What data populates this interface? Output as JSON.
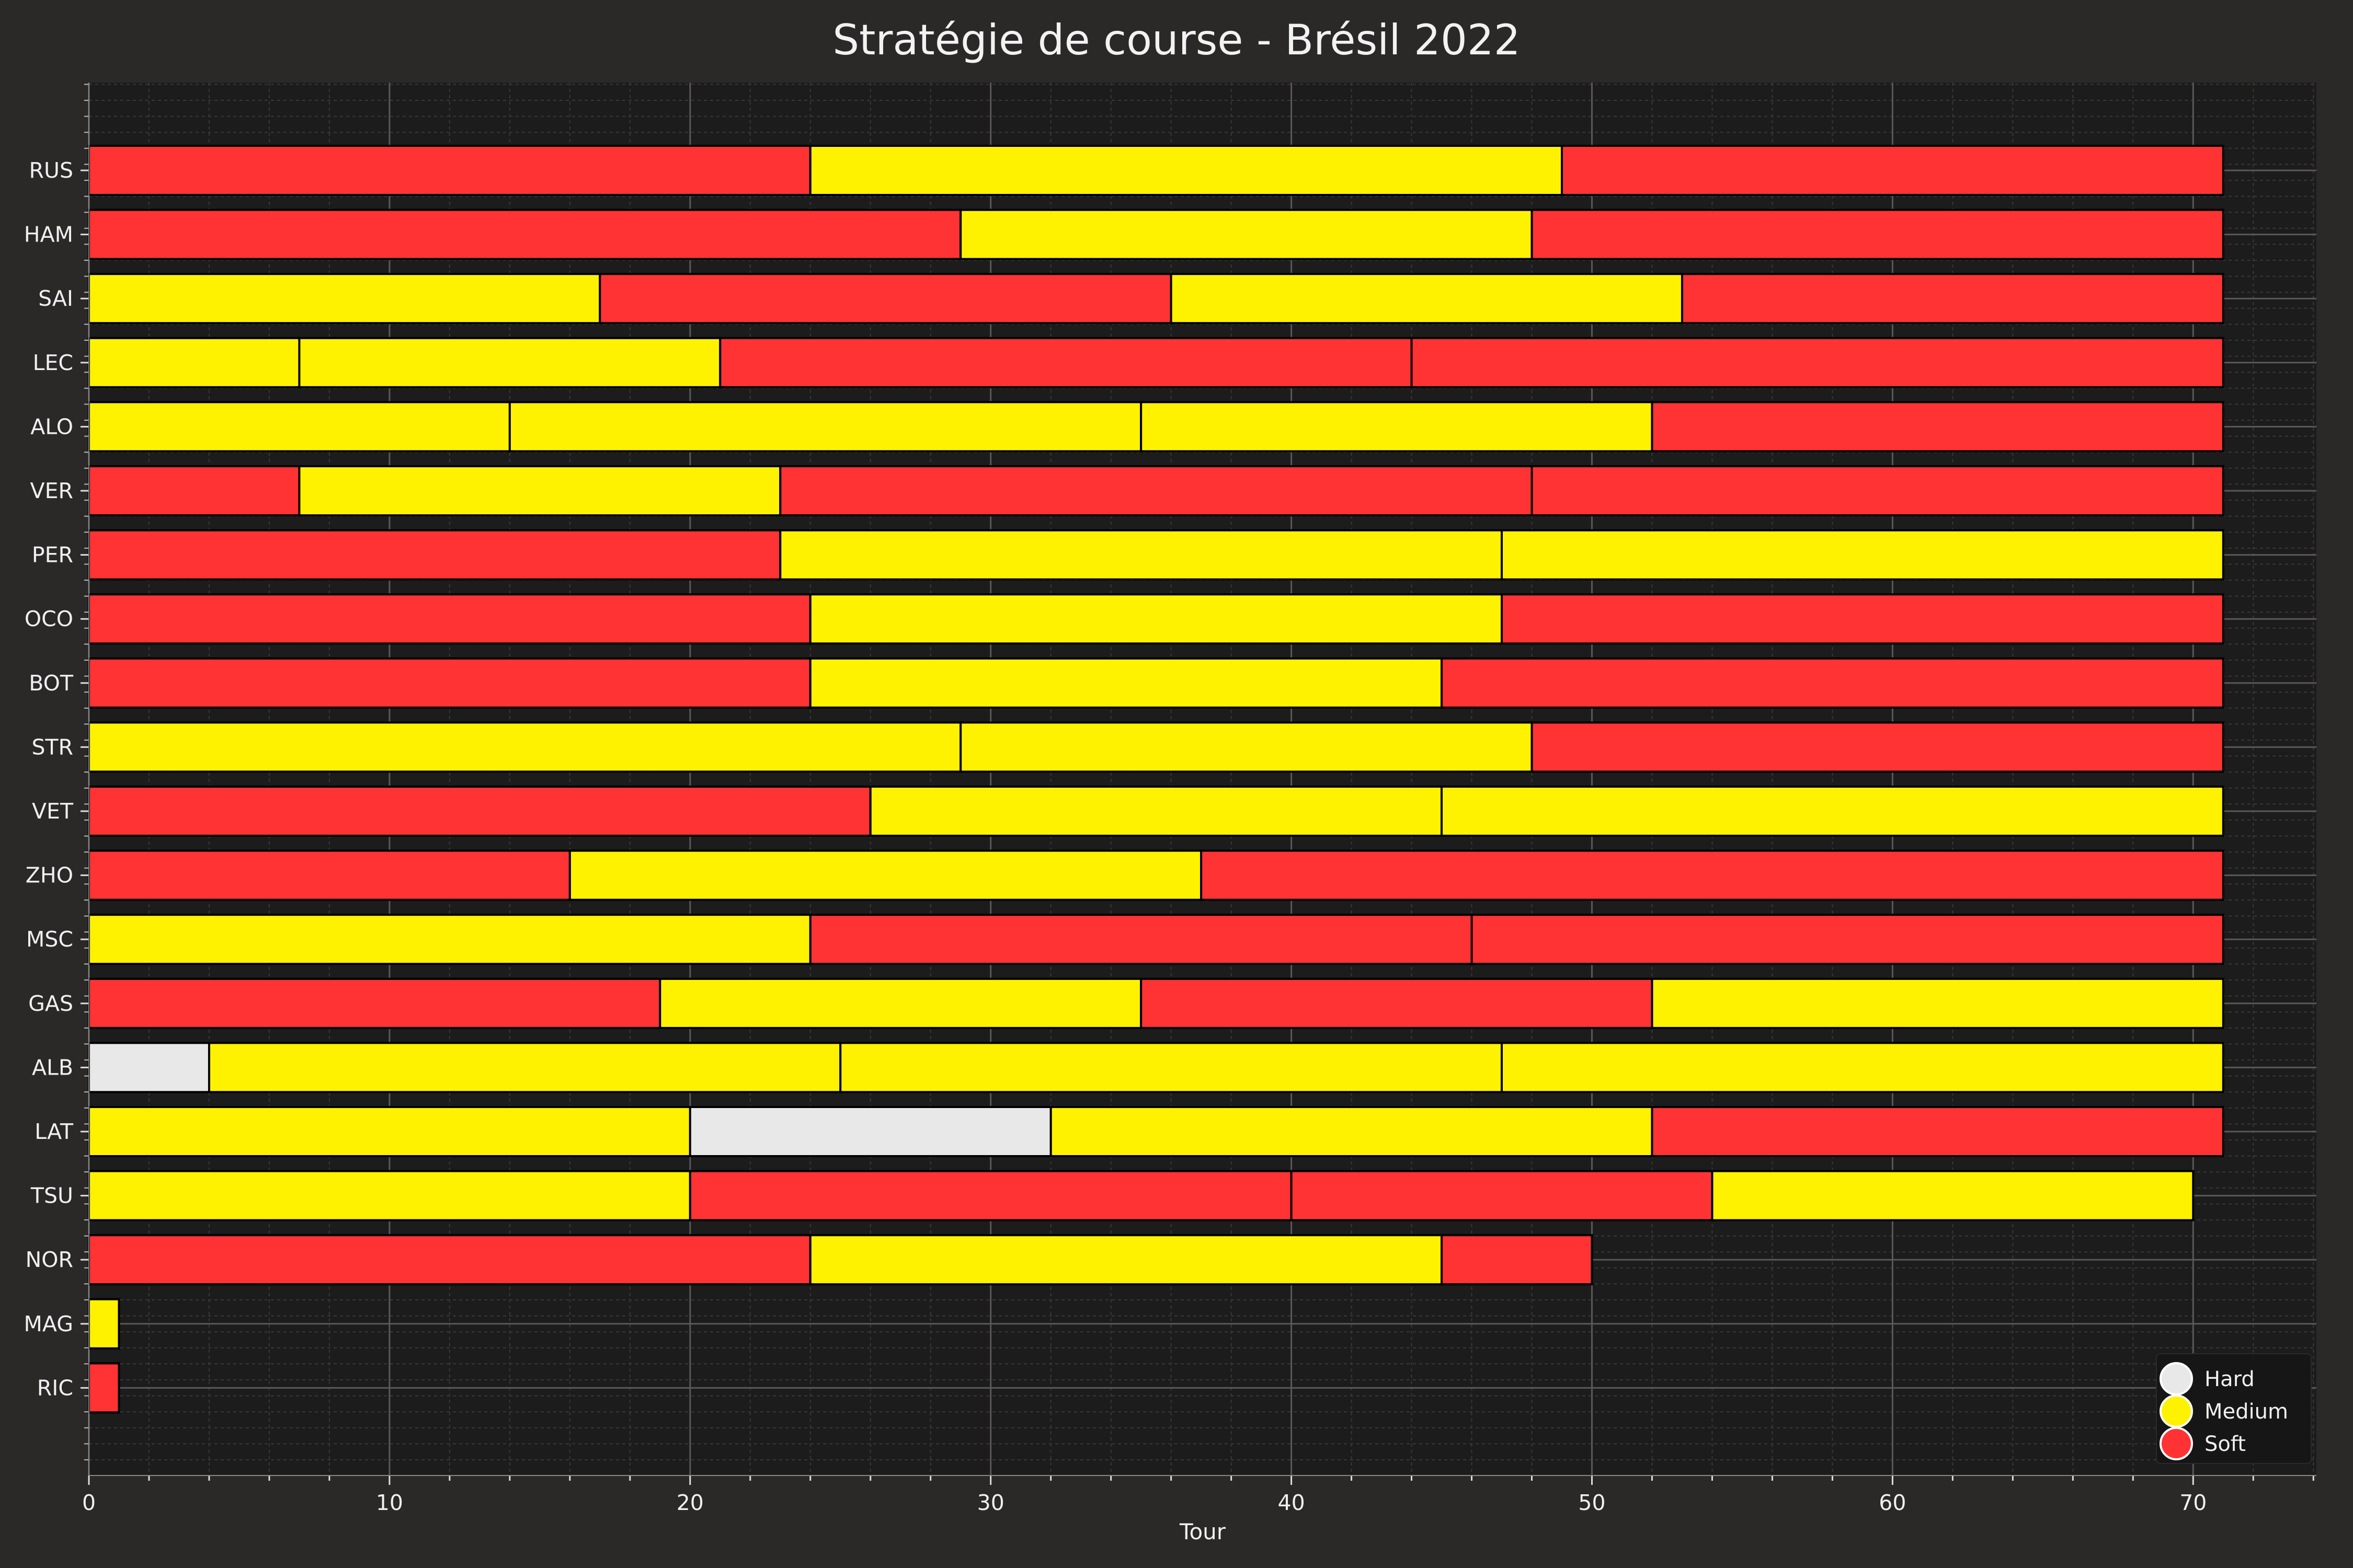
{
  "chart_data": {
    "type": "bar",
    "orientation": "horizontal-stacked",
    "title": "Stratégie de course - Brésil 2022",
    "xlabel": "Tour",
    "ylabel": "",
    "xlim": [
      0,
      74.1
    ],
    "xticks": [
      0,
      10,
      20,
      30,
      40,
      50,
      60,
      70
    ],
    "grid": true,
    "legend_position": "bottom-right",
    "compounds": [
      {
        "name": "Hard",
        "color": "#e8e8e8"
      },
      {
        "name": "Medium",
        "color": "#fff200"
      },
      {
        "name": "Soft",
        "color": "#ff3333"
      }
    ],
    "drivers": [
      {
        "driver": "RUS",
        "stints": [
          {
            "compound": "Soft",
            "start": 0,
            "end": 24
          },
          {
            "compound": "Medium",
            "start": 24,
            "end": 49
          },
          {
            "compound": "Soft",
            "start": 49,
            "end": 71
          }
        ]
      },
      {
        "driver": "HAM",
        "stints": [
          {
            "compound": "Soft",
            "start": 0,
            "end": 29
          },
          {
            "compound": "Medium",
            "start": 29,
            "end": 48
          },
          {
            "compound": "Soft",
            "start": 48,
            "end": 71
          }
        ]
      },
      {
        "driver": "SAI",
        "stints": [
          {
            "compound": "Medium",
            "start": 0,
            "end": 17
          },
          {
            "compound": "Soft",
            "start": 17,
            "end": 36
          },
          {
            "compound": "Medium",
            "start": 36,
            "end": 53
          },
          {
            "compound": "Soft",
            "start": 53,
            "end": 71
          }
        ]
      },
      {
        "driver": "LEC",
        "stints": [
          {
            "compound": "Medium",
            "start": 0,
            "end": 7
          },
          {
            "compound": "Medium",
            "start": 7,
            "end": 21
          },
          {
            "compound": "Soft",
            "start": 21,
            "end": 44
          },
          {
            "compound": "Soft",
            "start": 44,
            "end": 71
          }
        ]
      },
      {
        "driver": "ALO",
        "stints": [
          {
            "compound": "Medium",
            "start": 0,
            "end": 14
          },
          {
            "compound": "Medium",
            "start": 14,
            "end": 35
          },
          {
            "compound": "Medium",
            "start": 35,
            "end": 52
          },
          {
            "compound": "Soft",
            "start": 52,
            "end": 71
          }
        ]
      },
      {
        "driver": "VER",
        "stints": [
          {
            "compound": "Soft",
            "start": 0,
            "end": 7
          },
          {
            "compound": "Medium",
            "start": 7,
            "end": 23
          },
          {
            "compound": "Soft",
            "start": 23,
            "end": 48
          },
          {
            "compound": "Soft",
            "start": 48,
            "end": 71
          }
        ]
      },
      {
        "driver": "PER",
        "stints": [
          {
            "compound": "Soft",
            "start": 0,
            "end": 23
          },
          {
            "compound": "Medium",
            "start": 23,
            "end": 47
          },
          {
            "compound": "Medium",
            "start": 47,
            "end": 71
          }
        ]
      },
      {
        "driver": "OCO",
        "stints": [
          {
            "compound": "Soft",
            "start": 0,
            "end": 24
          },
          {
            "compound": "Medium",
            "start": 24,
            "end": 47
          },
          {
            "compound": "Soft",
            "start": 47,
            "end": 71
          }
        ]
      },
      {
        "driver": "BOT",
        "stints": [
          {
            "compound": "Soft",
            "start": 0,
            "end": 24
          },
          {
            "compound": "Medium",
            "start": 24,
            "end": 45
          },
          {
            "compound": "Soft",
            "start": 45,
            "end": 71
          }
        ]
      },
      {
        "driver": "STR",
        "stints": [
          {
            "compound": "Medium",
            "start": 0,
            "end": 29
          },
          {
            "compound": "Medium",
            "start": 29,
            "end": 48
          },
          {
            "compound": "Soft",
            "start": 48,
            "end": 71
          }
        ]
      },
      {
        "driver": "VET",
        "stints": [
          {
            "compound": "Soft",
            "start": 0,
            "end": 26
          },
          {
            "compound": "Medium",
            "start": 26,
            "end": 45
          },
          {
            "compound": "Medium",
            "start": 45,
            "end": 71
          }
        ]
      },
      {
        "driver": "ZHO",
        "stints": [
          {
            "compound": "Soft",
            "start": 0,
            "end": 16
          },
          {
            "compound": "Medium",
            "start": 16,
            "end": 37
          },
          {
            "compound": "Soft",
            "start": 37,
            "end": 71
          }
        ]
      },
      {
        "driver": "MSC",
        "stints": [
          {
            "compound": "Medium",
            "start": 0,
            "end": 24
          },
          {
            "compound": "Soft",
            "start": 24,
            "end": 46
          },
          {
            "compound": "Soft",
            "start": 46,
            "end": 71
          }
        ]
      },
      {
        "driver": "GAS",
        "stints": [
          {
            "compound": "Soft",
            "start": 0,
            "end": 19
          },
          {
            "compound": "Medium",
            "start": 19,
            "end": 35
          },
          {
            "compound": "Soft",
            "start": 35,
            "end": 52
          },
          {
            "compound": "Medium",
            "start": 52,
            "end": 71
          }
        ]
      },
      {
        "driver": "ALB",
        "stints": [
          {
            "compound": "Hard",
            "start": 0,
            "end": 4
          },
          {
            "compound": "Medium",
            "start": 4,
            "end": 25
          },
          {
            "compound": "Medium",
            "start": 25,
            "end": 47
          },
          {
            "compound": "Medium",
            "start": 47,
            "end": 71
          }
        ]
      },
      {
        "driver": "LAT",
        "stints": [
          {
            "compound": "Medium",
            "start": 0,
            "end": 20
          },
          {
            "compound": "Hard",
            "start": 20,
            "end": 32
          },
          {
            "compound": "Medium",
            "start": 32,
            "end": 52
          },
          {
            "compound": "Soft",
            "start": 52,
            "end": 71
          }
        ]
      },
      {
        "driver": "TSU",
        "stints": [
          {
            "compound": "Medium",
            "start": 0,
            "end": 20
          },
          {
            "compound": "Soft",
            "start": 20,
            "end": 40
          },
          {
            "compound": "Soft",
            "start": 40,
            "end": 54
          },
          {
            "compound": "Medium",
            "start": 54,
            "end": 70
          }
        ]
      },
      {
        "driver": "NOR",
        "stints": [
          {
            "compound": "Soft",
            "start": 0,
            "end": 24
          },
          {
            "compound": "Medium",
            "start": 24,
            "end": 45
          },
          {
            "compound": "Soft",
            "start": 45,
            "end": 50
          }
        ]
      },
      {
        "driver": "MAG",
        "stints": [
          {
            "compound": "Medium",
            "start": 0,
            "end": 1
          }
        ]
      },
      {
        "driver": "RIC",
        "stints": [
          {
            "compound": "Soft",
            "start": 0,
            "end": 1
          }
        ]
      }
    ]
  },
  "colors": {
    "background": "#2b2828",
    "plot_background": "#1c1c1c",
    "grid_major": "#5a5858",
    "grid_minor": "#3a3838",
    "bar_edge": "#000000"
  }
}
